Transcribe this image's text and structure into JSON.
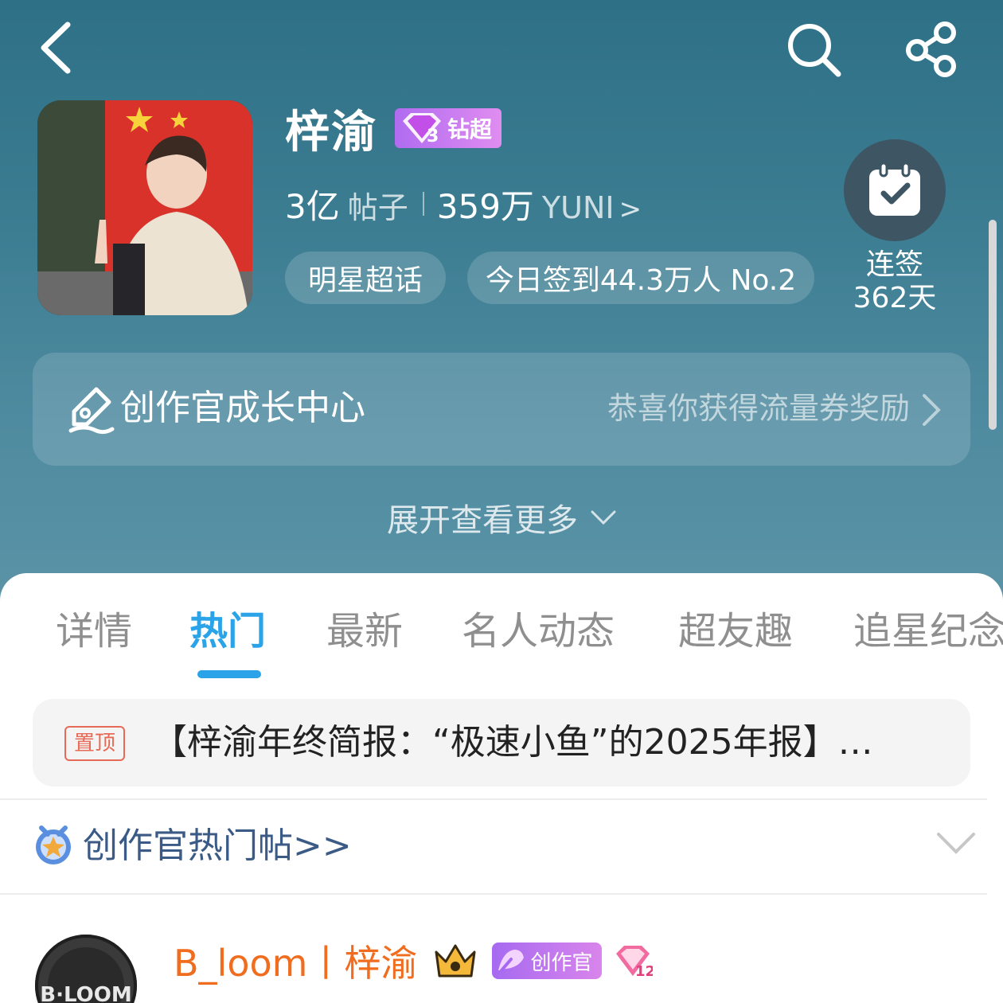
{
  "header": {
    "back_icon": "chevron-left-icon",
    "search_icon": "search-icon",
    "share_icon": "share-icon"
  },
  "topic": {
    "name": "梓渝",
    "badge_label": "钻超",
    "badge_level": "3",
    "posts_count": "3亿",
    "posts_label": "帖子",
    "fans_count": "359万",
    "fans_label": "YUNI",
    "fans_chevron": ">",
    "category_pill": "明星超话",
    "checkin_stat_pill": "今日签到44.3万人 No.2"
  },
  "checkin": {
    "icon": "calendar-check-icon",
    "line1": "连签",
    "line2": "362天"
  },
  "growth_center": {
    "title": "创作官成长中心",
    "subtitle": "恭喜你获得流量券奖励"
  },
  "expand_more": "展开查看更多",
  "tabs": [
    {
      "label": "详情",
      "active": false
    },
    {
      "label": "热门",
      "active": true
    },
    {
      "label": "最新",
      "active": false
    },
    {
      "label": "名人动态",
      "active": false
    },
    {
      "label": "超友趣",
      "active": false
    },
    {
      "label": "追星纪念",
      "active": false
    }
  ],
  "pinned": {
    "tag": "置顶",
    "text": "【梓渝年终简报：“极速小鱼”的2025年报】…"
  },
  "creator_hot": {
    "label": "创作官热门帖>>"
  },
  "post": {
    "author": "B_loom丨梓渝",
    "creator_badge": "创作官",
    "level_badge": "12",
    "avatar_text": "B·LOOM"
  },
  "colors": {
    "accent": "#2aa3e8",
    "author": "#f06d1f",
    "pin_tag": "#e66a55",
    "creator_link": "#3b5a86"
  }
}
